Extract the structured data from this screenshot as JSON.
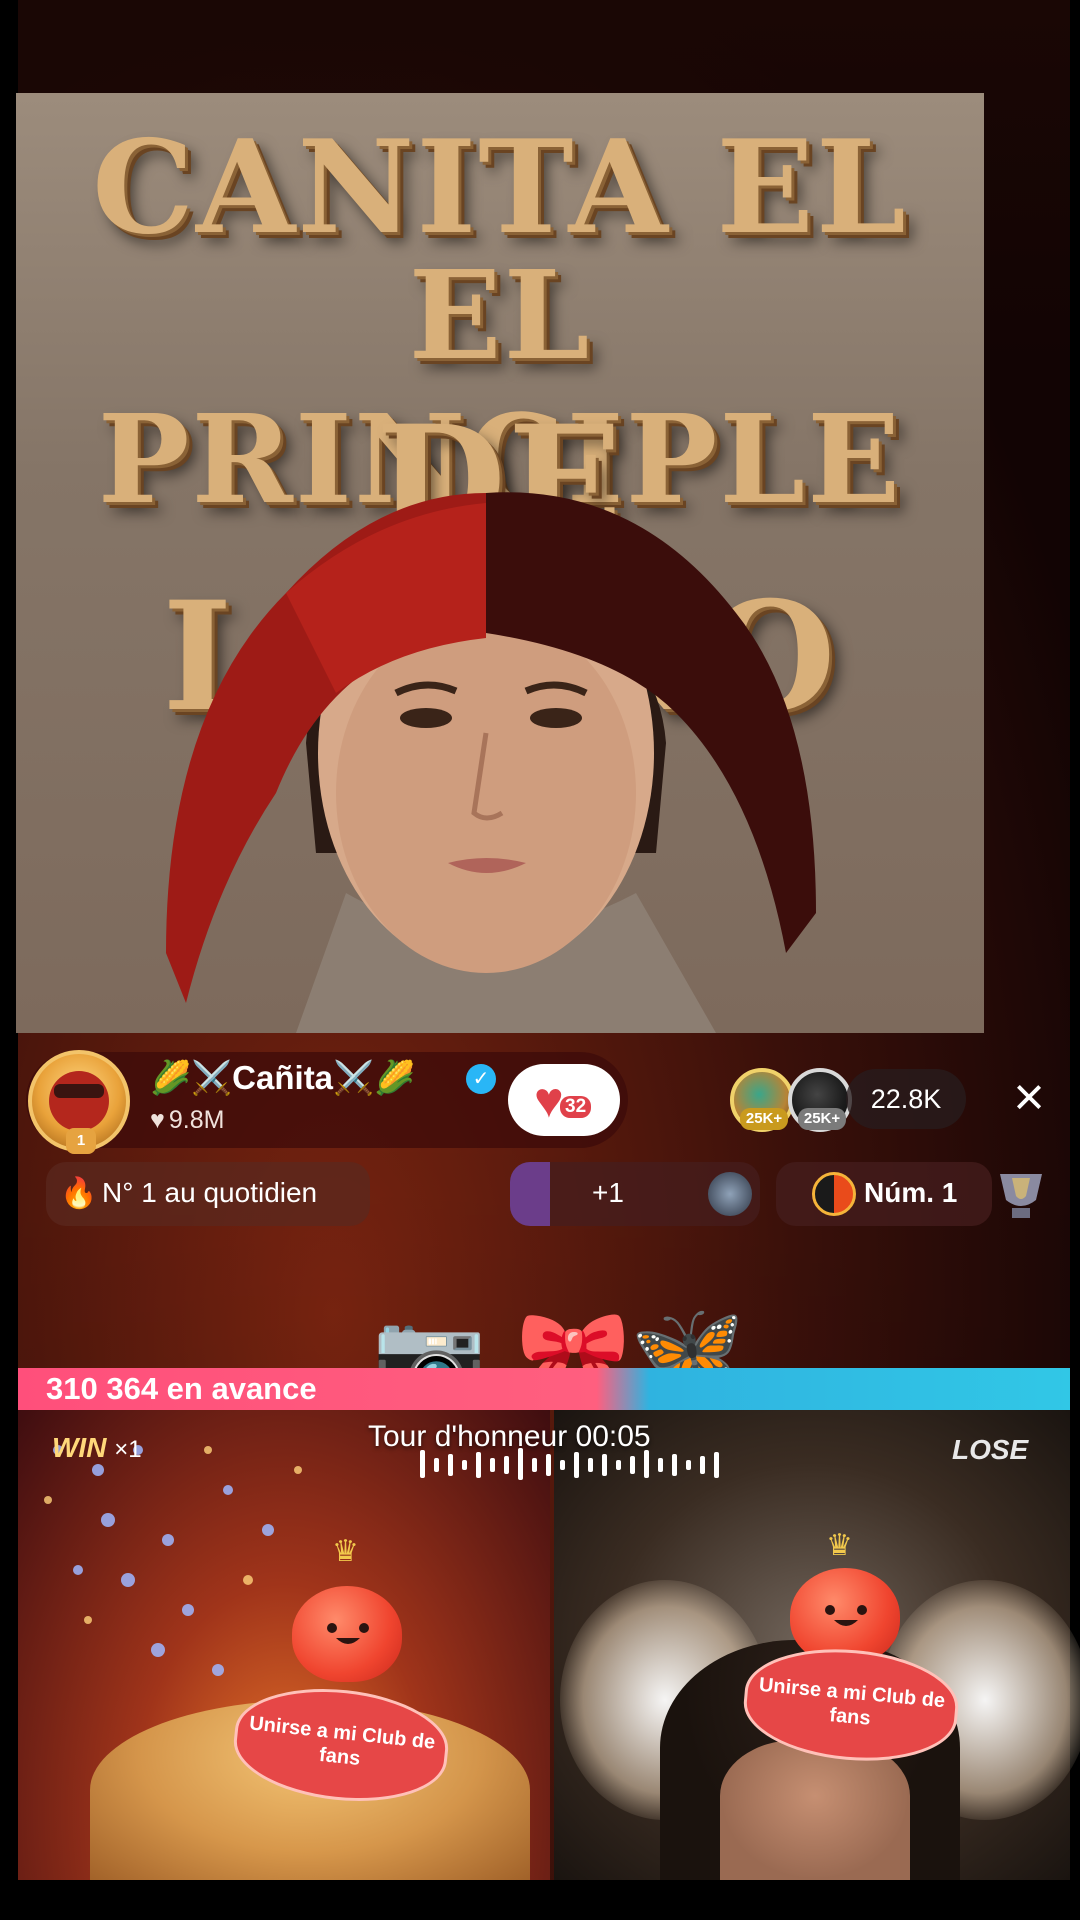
{
  "cover": {
    "title_line_1": "CANITA EL",
    "title_line_2": "EL PRINCIPLE",
    "title_line_3": "DE LATINO"
  },
  "host": {
    "name": "🌽⚔️Cañita⚔️🌽",
    "likes": "9.8M",
    "fanclub_level": "32",
    "avatar_badge": "1"
  },
  "viewers": {
    "badge_1": "25K+",
    "badge_2": "25K+",
    "count": "22.8K"
  },
  "chips": {
    "rank": "N° 1 au quotidien",
    "gift_delta": "+1",
    "num_rank": "Núm. 1"
  },
  "battle": {
    "lead_text": "310 364 en avance",
    "round_text": "Tour d'honneur  00:05",
    "win_label": "WIN",
    "win_count": "×1",
    "lose_label": "LOSE",
    "club_cta_left": "Unirse a mi Club de fans",
    "club_cta_right": "Unirse a mi Club de fans"
  },
  "colors": {
    "lead_bar_pink": "#ff4f7b",
    "lead_bar_blue": "#31c7e6",
    "accent_gold": "#f3c46a",
    "fanclub_red": "#e0414a"
  },
  "icons": {
    "close": "close-icon",
    "verified": "verified-icon",
    "fire": "fire-icon",
    "heart": "heart-icon"
  }
}
